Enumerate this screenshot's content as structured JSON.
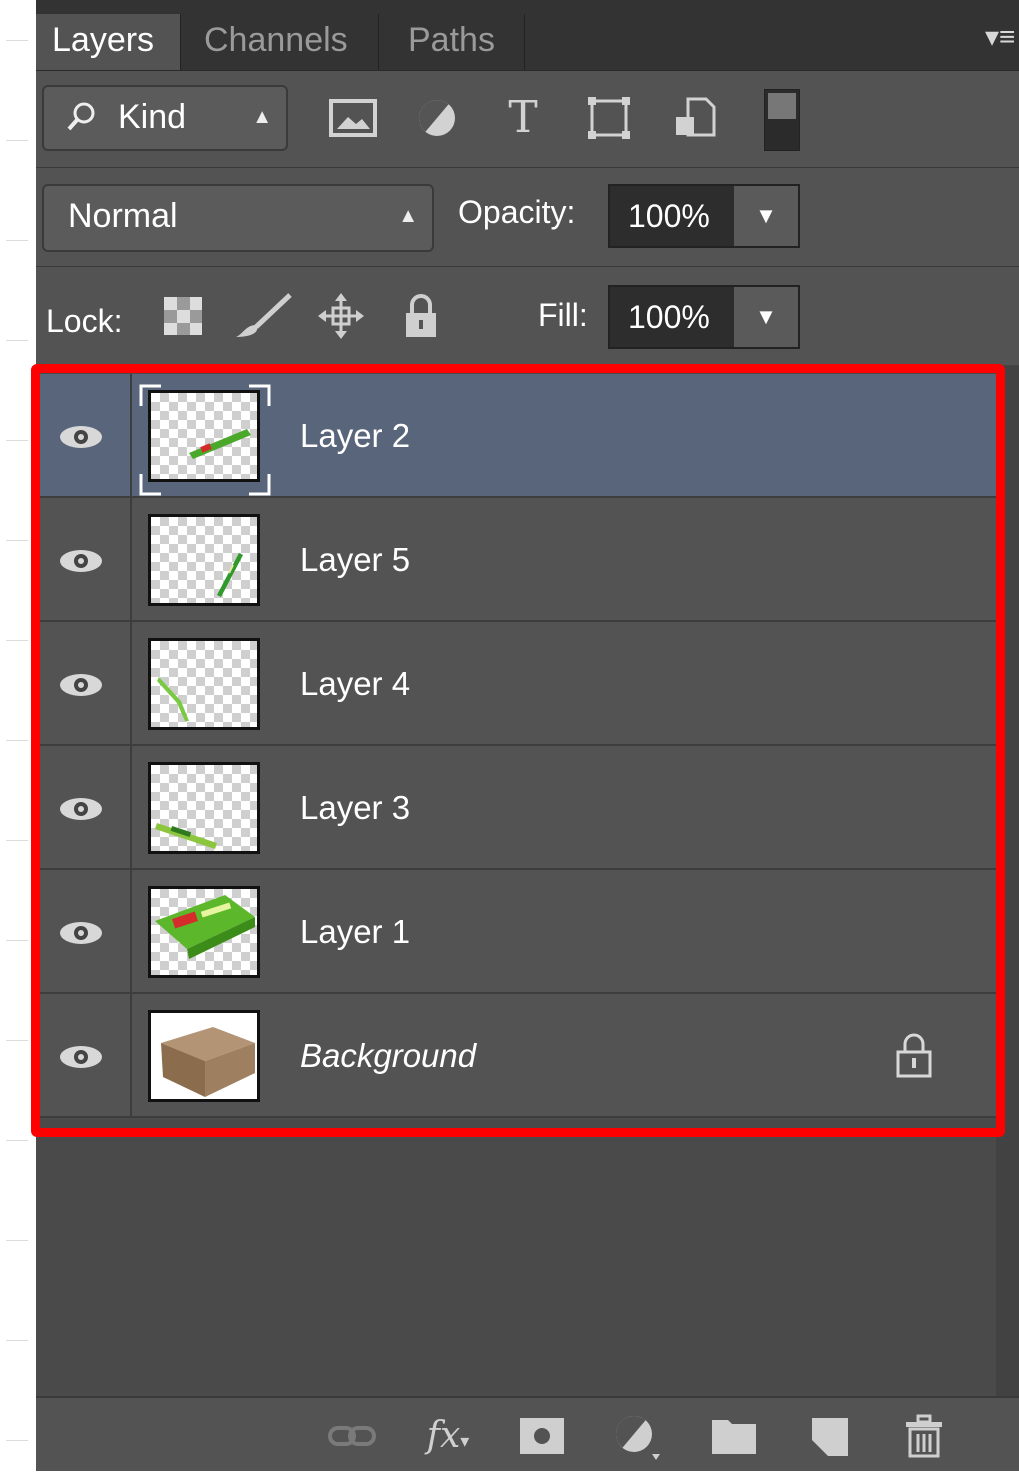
{
  "tabs": [
    {
      "label": "Layers",
      "active": true
    },
    {
      "label": "Channels",
      "active": false
    },
    {
      "label": "Paths",
      "active": false
    }
  ],
  "filter": {
    "kind_label": "Kind",
    "filter_icons": [
      "pixel-layer-filter-icon",
      "adjustment-layer-filter-icon",
      "type-layer-filter-icon",
      "shape-layer-filter-icon",
      "smart-object-filter-icon"
    ]
  },
  "blend": {
    "mode": "Normal",
    "opacity_label": "Opacity:",
    "opacity_value": "100%"
  },
  "lock": {
    "label": "Lock:",
    "fill_label": "Fill:",
    "fill_value": "100%"
  },
  "layers": [
    {
      "name": "Layer 2",
      "visible": true,
      "selected": true
    },
    {
      "name": "Layer 5",
      "visible": true,
      "selected": false
    },
    {
      "name": "Layer 4",
      "visible": true,
      "selected": false
    },
    {
      "name": "Layer 3",
      "visible": true,
      "selected": false
    },
    {
      "name": "Layer 1",
      "visible": true,
      "selected": false
    },
    {
      "name": "Background",
      "visible": true,
      "selected": false,
      "locked": true
    }
  ],
  "bottom_bar": [
    "link-layers-icon",
    "layer-style-fx-icon",
    "add-mask-icon",
    "adjustment-layer-icon",
    "new-group-folder-icon",
    "new-layer-icon",
    "delete-trash-icon"
  ],
  "colors": {
    "panel_bg": "#535353",
    "selected_row": "#59657a",
    "highlight_border": "#ff0000"
  }
}
